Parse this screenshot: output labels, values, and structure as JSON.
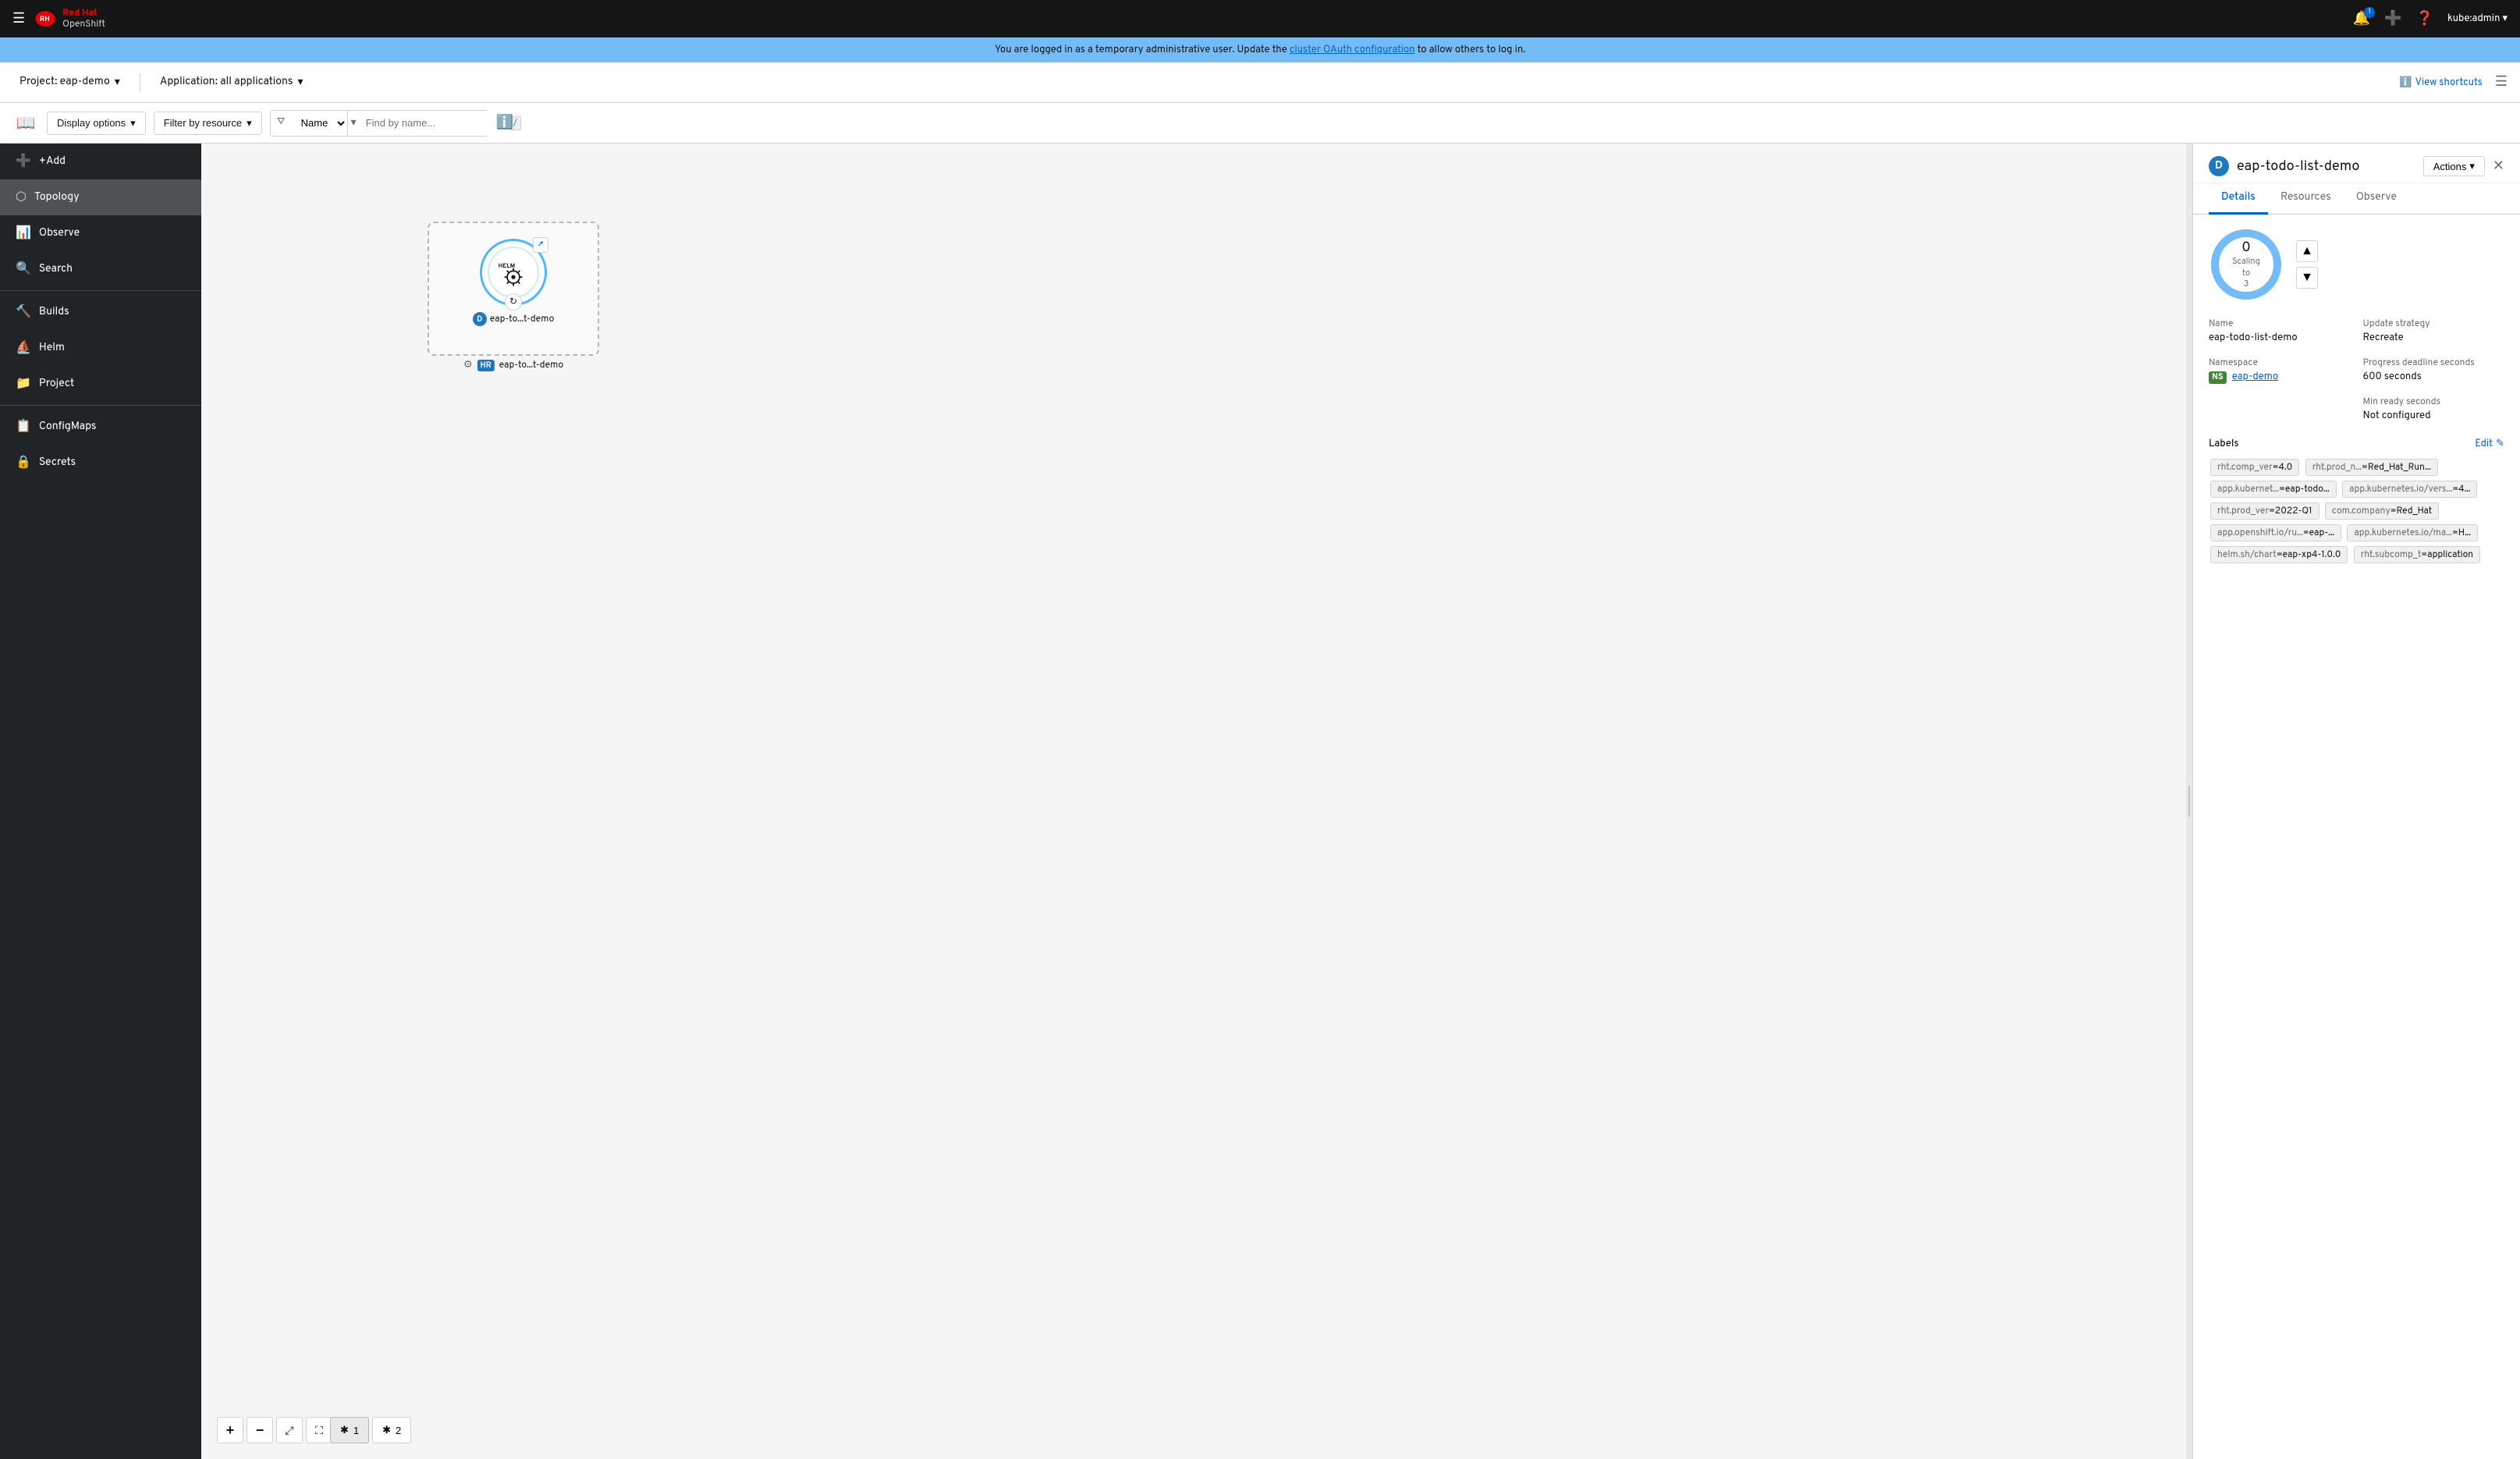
{
  "topnav": {
    "hamburger_label": "☰",
    "brand_red": "Red Hat",
    "brand_name": "OpenShift",
    "bell_count": "1",
    "user": "kube:admin ▾"
  },
  "banner": {
    "text_before": "You are logged in as a temporary administrative user. Update the ",
    "link_text": "cluster OAuth configuration",
    "text_after": " to allow others to log in."
  },
  "project_bar": {
    "project_label": "Project: eap-demo",
    "application_label": "Application: all applications",
    "view_shortcuts": "View shortcuts"
  },
  "toolbar": {
    "book_icon_label": "📖",
    "display_options": "Display options",
    "filter_by_resource": "Filter by resource",
    "filter_name": "Name",
    "search_placeholder": "Find by name...",
    "slash_key": "/",
    "info_icon": "ℹ"
  },
  "sidebar": {
    "items": [
      {
        "id": "add",
        "label": "+Add",
        "icon": "➕",
        "active": false
      },
      {
        "id": "topology",
        "label": "Topology",
        "icon": "⬡",
        "active": true
      },
      {
        "id": "observe",
        "label": "Observe",
        "icon": "📊",
        "active": false
      },
      {
        "id": "search",
        "label": "Search",
        "icon": "🔍",
        "active": false
      },
      {
        "id": "builds",
        "label": "Builds",
        "icon": "🔨",
        "active": false
      },
      {
        "id": "helm",
        "label": "Helm",
        "icon": "⛵",
        "active": false
      },
      {
        "id": "project",
        "label": "Project",
        "icon": "📁",
        "active": false
      },
      {
        "id": "configmaps",
        "label": "ConfigMaps",
        "icon": "📋",
        "active": false
      },
      {
        "id": "secrets",
        "label": "Secrets",
        "icon": "🔒",
        "active": false
      }
    ]
  },
  "topology": {
    "node": {
      "name": "eap-to...t-demo",
      "name_full": "eap-todo-list-demo",
      "d_badge": "D",
      "hr_badge": "HR",
      "helm_release_label": "eap-to...t-demo",
      "gear_icon": "⚙"
    }
  },
  "zoom_controls": {
    "zoom_out": "−",
    "zoom_in": "+",
    "fit": "⤢",
    "expand": "⛶",
    "filter1_icon": "✱",
    "filter1_label": "1",
    "filter2_icon": "✱",
    "filter2_label": "2"
  },
  "right_panel": {
    "d_badge": "D",
    "title": "eap-todo-list-demo",
    "close_icon": "✕",
    "actions_label": "Actions",
    "tabs": [
      {
        "id": "details",
        "label": "Details",
        "active": true
      },
      {
        "id": "resources",
        "label": "Resources",
        "active": false
      },
      {
        "id": "observe",
        "label": "Observe",
        "active": false
      }
    ],
    "scaling": {
      "count": "0",
      "label": "Scaling to",
      "target": "3",
      "up_icon": "▲",
      "down_icon": "▼"
    },
    "details": {
      "name_label": "Name",
      "name_value": "eap-todo-list-demo",
      "update_strategy_label": "Update strategy",
      "update_strategy_value": "Recreate",
      "namespace_label": "Namespace",
      "namespace_badge": "NS",
      "namespace_value": "eap-demo",
      "progress_deadline_label": "Progress deadline seconds",
      "progress_deadline_value": "600 seconds",
      "min_ready_label": "Min ready seconds",
      "min_ready_value": "Not configured"
    },
    "labels": {
      "section_title": "Labels",
      "edit_label": "Edit",
      "edit_icon": "✎",
      "items": [
        {
          "key": "rht.comp_ver",
          "value": "=4.0"
        },
        {
          "key": "rht.prod_n...",
          "value": "=Red_Hat_Run..."
        },
        {
          "key": "app.kubernet...",
          "value": "=eap-todo..."
        },
        {
          "key": "app.kubernetes.io/vers...",
          "value": "=4..."
        },
        {
          "key": "rht.prod_ver",
          "value": "=2022-Q1"
        },
        {
          "key": "com.company",
          "value": "=Red_Hat"
        },
        {
          "key": "app.openshift.io/ru...",
          "value": "=eap-..."
        },
        {
          "key": "app.kubernetes.io/ma...",
          "value": "=H..."
        },
        {
          "key": "helm.sh/chart",
          "value": "=eap-xp4-1.0.0"
        },
        {
          "key": "rht.subcomp_t",
          "value": "=application"
        }
      ]
    }
  },
  "colors": {
    "accent_blue": "#06c",
    "active_tab": "#06c",
    "ring_bg": "#bee1f4",
    "ring_fg": "#73bcf7",
    "sidebar_bg": "#212427",
    "sidebar_active": "#4f5255"
  }
}
